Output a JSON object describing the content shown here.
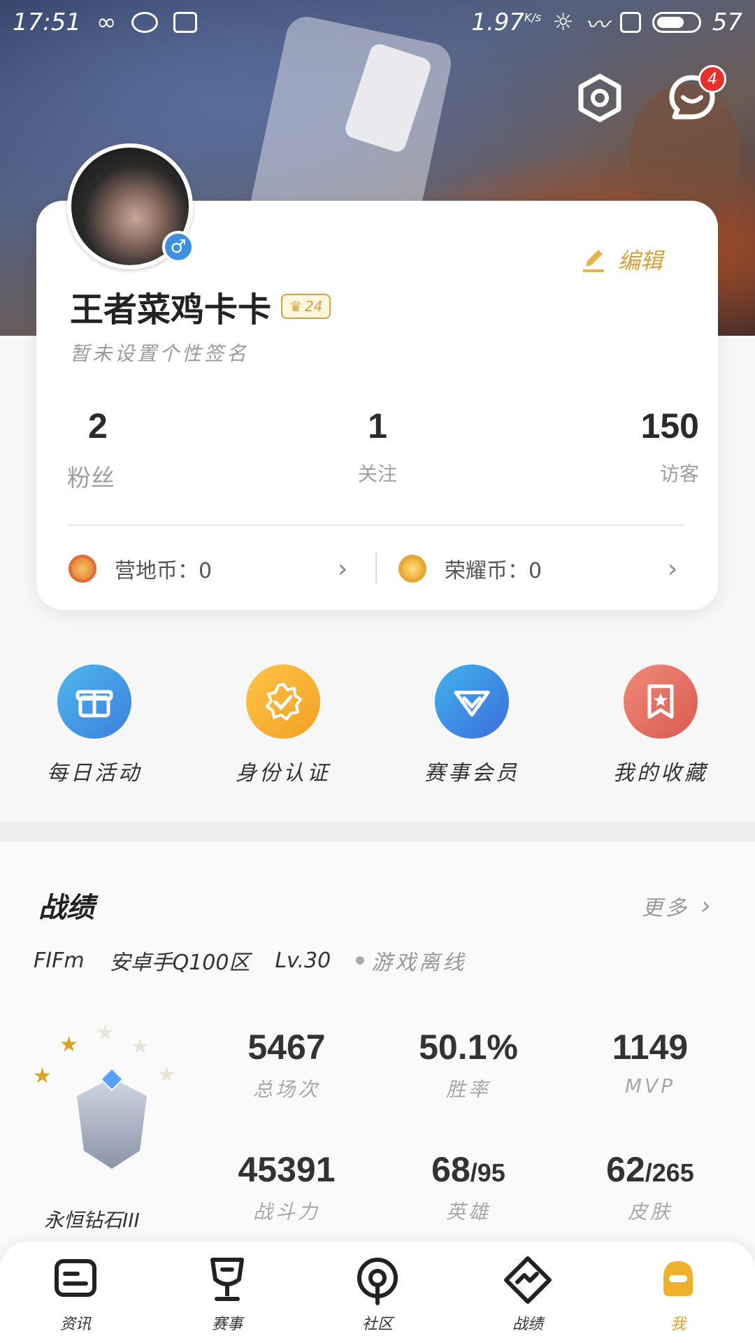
{
  "status_bar": {
    "time": "17:51",
    "speed": "1.97",
    "speed_unit": "K/s",
    "battery": "57"
  },
  "header": {
    "message_badge": "4"
  },
  "profile": {
    "username": "王者菜鸡卡卡",
    "level": "24",
    "signature": "暂未设置个性签名",
    "edit_label": "编辑",
    "gender_symbol": "♂",
    "stats": {
      "fans_value": "2",
      "fans_label": "粉丝",
      "follow_value": "1",
      "follow_label": "关注",
      "visitors_value": "150",
      "visitors_label": "访客"
    },
    "coins": {
      "camp_label": "营地币：0",
      "honor_label": "荣耀币：0"
    }
  },
  "quick_actions": [
    {
      "label": "每日活动",
      "icon": "gift-icon"
    },
    {
      "label": "身份认证",
      "icon": "verified-badge-icon"
    },
    {
      "label": "赛事会员",
      "icon": "diamond-icon"
    },
    {
      "label": "我的收藏",
      "icon": "bookmark-star-icon"
    }
  ],
  "records": {
    "title": "战绩",
    "more_label": "更多",
    "player_name": "FIFm",
    "server": "安卓手Q100区",
    "level": "Lv.30",
    "online_status": "游戏离线",
    "rank_name": "永恒钻石III",
    "stats": [
      {
        "value": "5467",
        "label": "总场次"
      },
      {
        "value": "50.1%",
        "label": "胜率"
      },
      {
        "value": "1149",
        "label": "MVP"
      },
      {
        "value": "45391",
        "label": "战斗力"
      },
      {
        "value": "68",
        "total": "/95",
        "label": "英雄"
      },
      {
        "value": "62",
        "total": "/265",
        "label": "皮肤"
      }
    ]
  },
  "bottom_nav": [
    {
      "label": "资讯",
      "icon": "news-icon"
    },
    {
      "label": "赛事",
      "icon": "trophy-icon"
    },
    {
      "label": "社区",
      "icon": "community-icon"
    },
    {
      "label": "战绩",
      "icon": "stats-chart-icon"
    },
    {
      "label": "我",
      "icon": "profile-icon",
      "active": true
    }
  ],
  "colors": {
    "accent": "#e0a42a",
    "badge": "#e8302b",
    "gender": "#3d8fe0"
  }
}
